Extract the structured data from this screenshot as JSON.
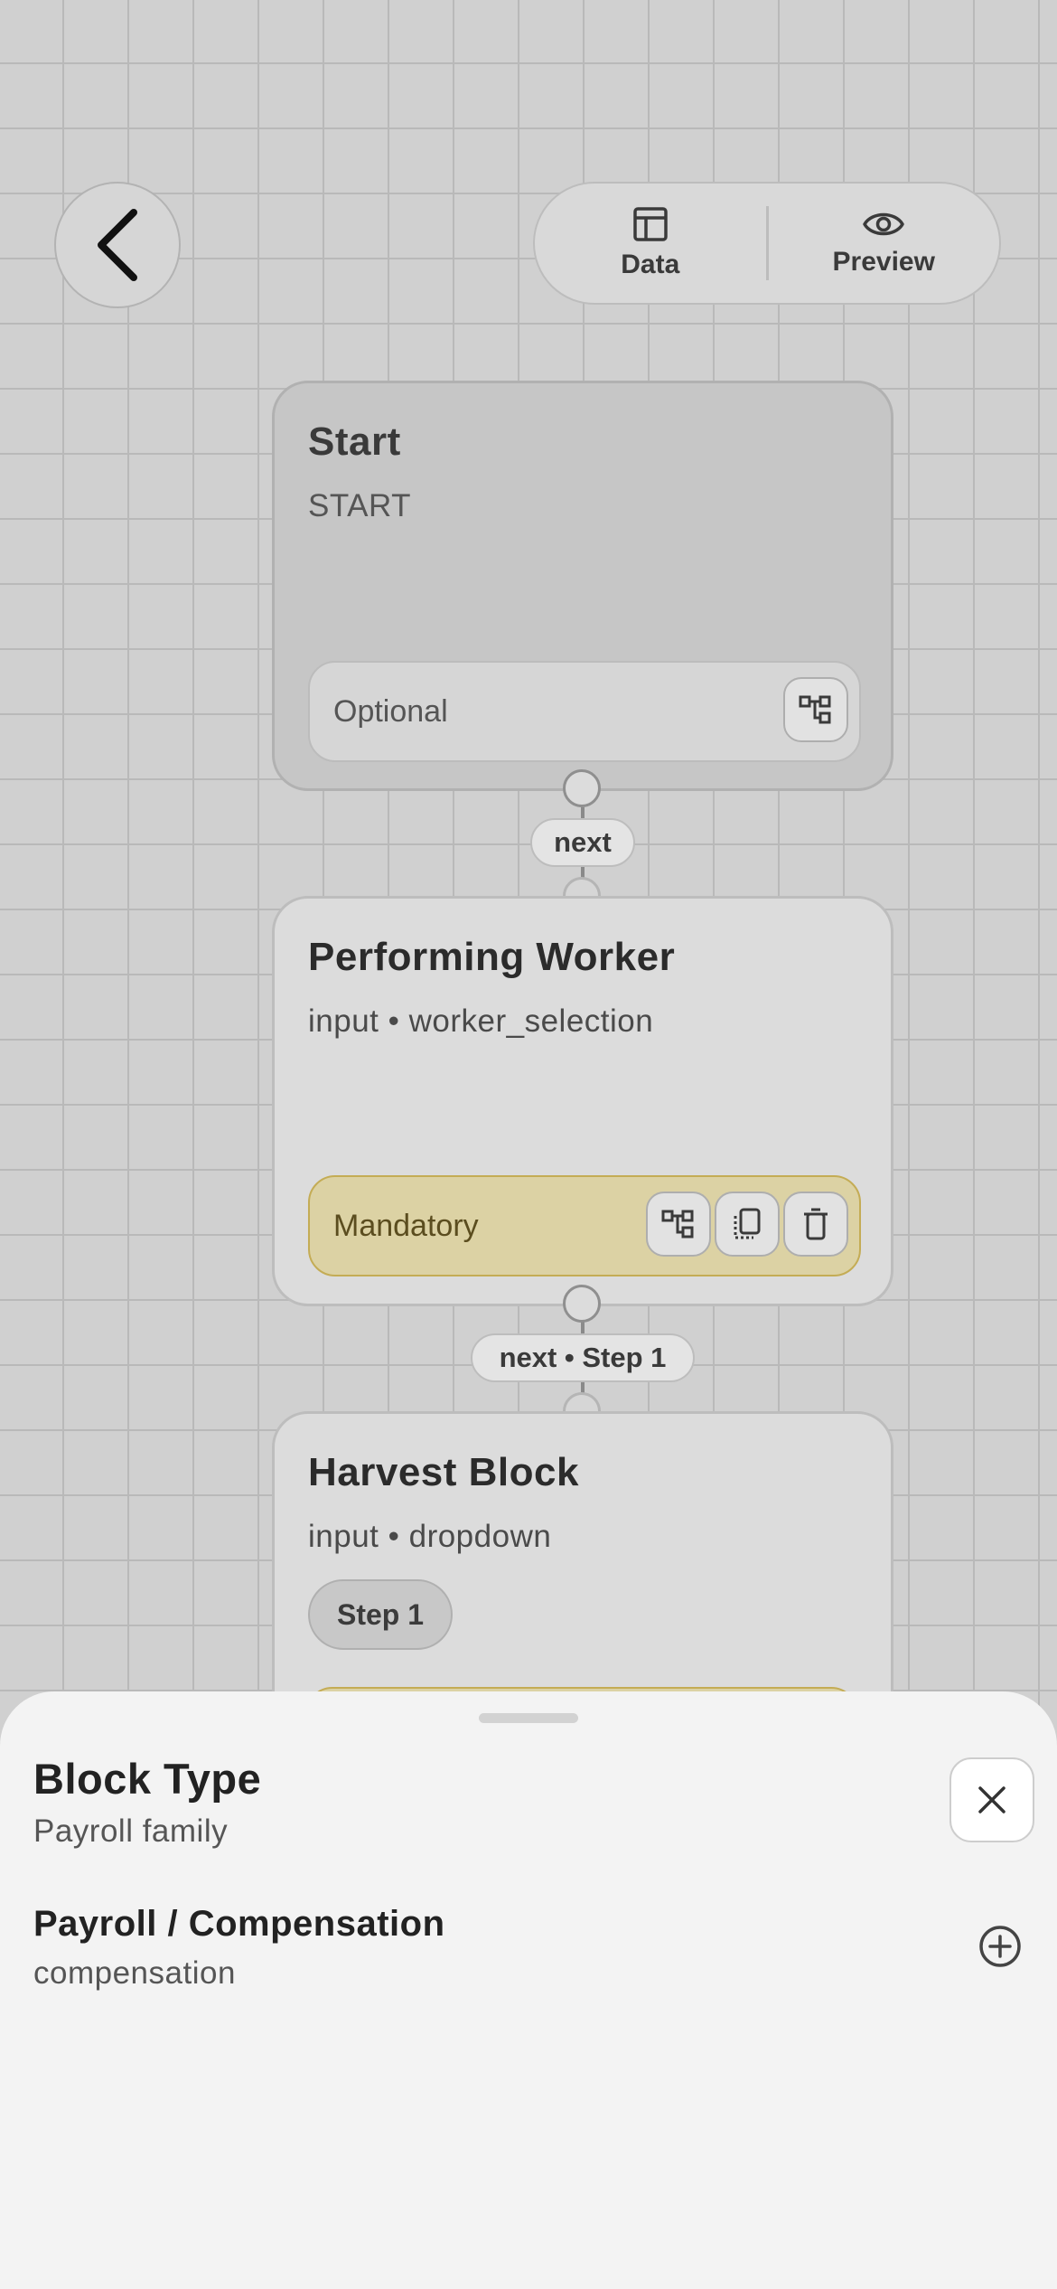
{
  "toolbar": {
    "data_label": "Data",
    "preview_label": "Preview"
  },
  "nodes": [
    {
      "title": "Start",
      "subtitle": "START",
      "footer_label": "Optional"
    },
    {
      "title": "Performing Worker",
      "subtitle": "input • worker_selection",
      "footer_label": "Mandatory"
    },
    {
      "title": "Harvest Block",
      "subtitle": "input • dropdown",
      "tag": "Step 1"
    }
  ],
  "edges": [
    {
      "label": "next"
    },
    {
      "label": "next • Step 1"
    }
  ],
  "sheet": {
    "title": "Block Type",
    "subtitle": "Payroll family",
    "option": {
      "title": "Payroll / Compensation",
      "subtitle": "compensation"
    }
  },
  "colors": {
    "canvas": "#d0d0d0",
    "grid": "#b9b9b9",
    "mandatory_fill": "#dcd2a4",
    "mandatory_border": "#c4ac55",
    "sheet_bg": "#f3f3f3"
  }
}
